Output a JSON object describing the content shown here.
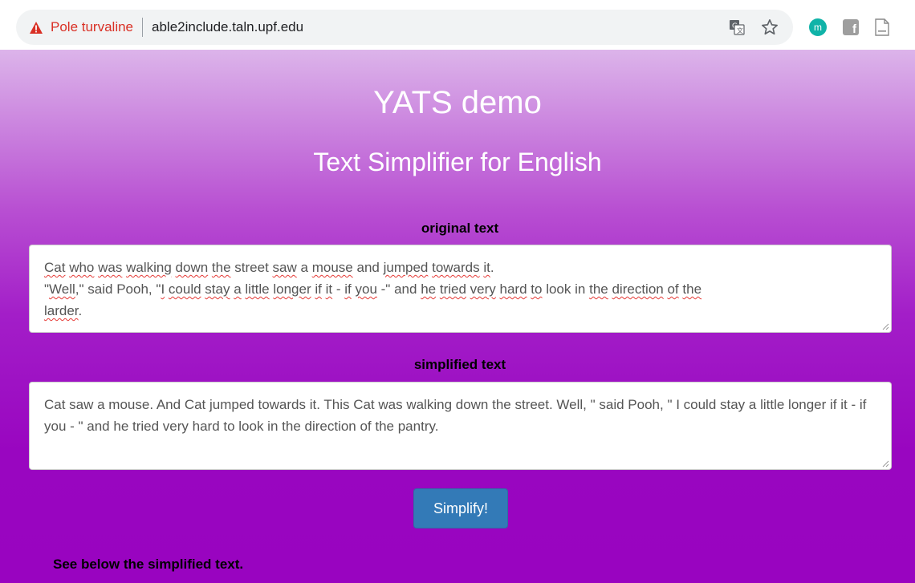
{
  "browser": {
    "security_label": "Pole turvaline",
    "url": "able2include.taln.upf.edu",
    "extension_m_letter": "m",
    "extension_f_letter": "f"
  },
  "page": {
    "title": "YATS demo",
    "subtitle": "Text Simplifier for English",
    "original_label": "original text",
    "original_text_lines": [
      "Cat who was walking down the street saw a mouse and jumped towards it.",
      "\"Well,\" said Pooh, \"I could stay a little longer if it - if you -\" and he tried very hard to look in the direction of the",
      "larder."
    ],
    "simplified_label": "simplified text",
    "simplified_text": "Cat saw a mouse. And Cat jumped towards it. This Cat was walking down the street. Well, \" said Pooh, \" I could stay a little longer if it - if you - \" and he tried very hard to look in the direction of the pantry.",
    "simplify_button": "Simplify!",
    "footer_note": "See below the simplified text."
  },
  "colors": {
    "accent_button": "#337ab7",
    "warning": "#d93025",
    "page_gradient_top": "#dcb4ea",
    "page_gradient_bottom": "#9904c0"
  }
}
